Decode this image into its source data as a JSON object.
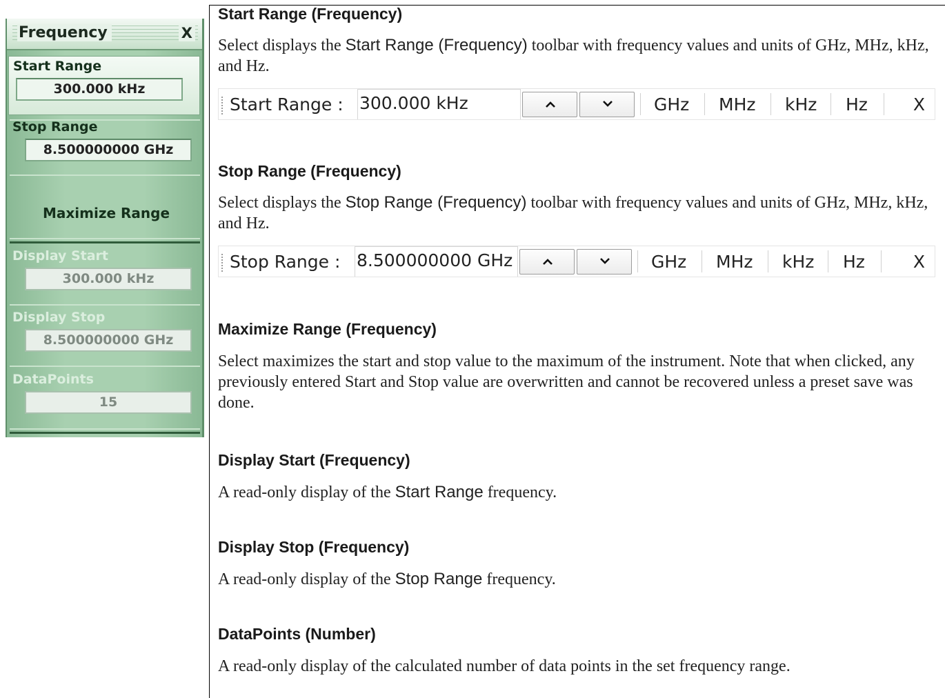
{
  "menu": {
    "title": "Frequency",
    "close": "X",
    "start_range": {
      "label": "Start Range",
      "value": "300.000 kHz"
    },
    "stop_range": {
      "label": "Stop Range",
      "value": "8.500000000 GHz"
    },
    "maximize": "Maximize Range",
    "display_start": {
      "label": "Display Start",
      "value": "300.000 kHz"
    },
    "display_stop": {
      "label": "Display Stop",
      "value": "8.500000000 GHz"
    },
    "datapoints": {
      "label": "DataPoints",
      "value": "15"
    }
  },
  "sections": {
    "start": {
      "heading": "Start Range (Frequency)",
      "text_a": "Select displays the ",
      "text_ui": "Start Range (Frequency)",
      "text_b": " toolbar with frequency values and units of GHz, MHz, kHz, and Hz."
    },
    "stop": {
      "heading": "Stop Range (Frequency)",
      "text_a": "Select displays the ",
      "text_ui": "Stop Range (Frequency)",
      "text_b": " toolbar with frequency values and units of GHz, MHz, kHz, and Hz."
    },
    "maximize": {
      "heading": "Maximize Range (Frequency)",
      "text": "Select maximizes the start and stop value to the maximum of the instrument. Note that when clicked, any previously entered Start and Stop value are overwritten and cannot be recovered unless a preset save was done."
    },
    "display_start": {
      "heading": "Display Start (Frequency)",
      "text_a": "A read-only display of the ",
      "text_ui": "Start Range",
      "text_b": " frequency."
    },
    "display_stop": {
      "heading": "Display Stop (Frequency)",
      "text_a": "A read-only display of the ",
      "text_ui": "Stop Range",
      "text_b": " frequency."
    },
    "datapoints": {
      "heading": "DataPoints (Number)",
      "text": "A read-only display of the calculated number of data points in the set frequency range."
    }
  },
  "toolbar_start": {
    "label": "Start Range :",
    "value": "300.000 kHz",
    "units": [
      "GHz",
      "MHz",
      "kHz",
      "Hz"
    ],
    "close": "X"
  },
  "toolbar_stop": {
    "label": "Stop Range :",
    "value": "8.500000000 GHz",
    "units": [
      "GHz",
      "MHz",
      "kHz",
      "Hz"
    ],
    "close": "X"
  }
}
